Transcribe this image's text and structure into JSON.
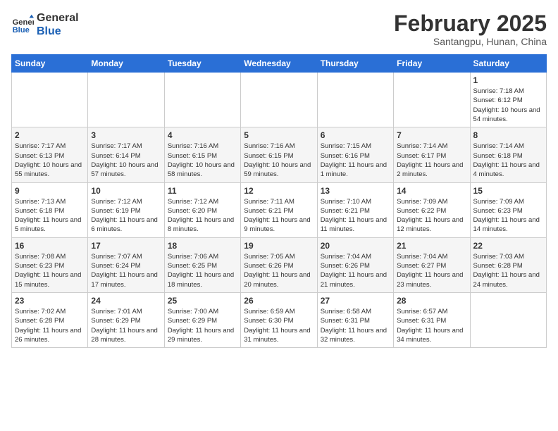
{
  "logo": {
    "line1": "General",
    "line2": "Blue"
  },
  "title": "February 2025",
  "location": "Santangpu, Hunan, China",
  "weekdays": [
    "Sunday",
    "Monday",
    "Tuesday",
    "Wednesday",
    "Thursday",
    "Friday",
    "Saturday"
  ],
  "weeks": [
    [
      {
        "day": "",
        "info": ""
      },
      {
        "day": "",
        "info": ""
      },
      {
        "day": "",
        "info": ""
      },
      {
        "day": "",
        "info": ""
      },
      {
        "day": "",
        "info": ""
      },
      {
        "day": "",
        "info": ""
      },
      {
        "day": "1",
        "info": "Sunrise: 7:18 AM\nSunset: 6:12 PM\nDaylight: 10 hours and 54 minutes."
      }
    ],
    [
      {
        "day": "2",
        "info": "Sunrise: 7:17 AM\nSunset: 6:13 PM\nDaylight: 10 hours and 55 minutes."
      },
      {
        "day": "3",
        "info": "Sunrise: 7:17 AM\nSunset: 6:14 PM\nDaylight: 10 hours and 57 minutes."
      },
      {
        "day": "4",
        "info": "Sunrise: 7:16 AM\nSunset: 6:15 PM\nDaylight: 10 hours and 58 minutes."
      },
      {
        "day": "5",
        "info": "Sunrise: 7:16 AM\nSunset: 6:15 PM\nDaylight: 10 hours and 59 minutes."
      },
      {
        "day": "6",
        "info": "Sunrise: 7:15 AM\nSunset: 6:16 PM\nDaylight: 11 hours and 1 minute."
      },
      {
        "day": "7",
        "info": "Sunrise: 7:14 AM\nSunset: 6:17 PM\nDaylight: 11 hours and 2 minutes."
      },
      {
        "day": "8",
        "info": "Sunrise: 7:14 AM\nSunset: 6:18 PM\nDaylight: 11 hours and 4 minutes."
      }
    ],
    [
      {
        "day": "9",
        "info": "Sunrise: 7:13 AM\nSunset: 6:18 PM\nDaylight: 11 hours and 5 minutes."
      },
      {
        "day": "10",
        "info": "Sunrise: 7:12 AM\nSunset: 6:19 PM\nDaylight: 11 hours and 6 minutes."
      },
      {
        "day": "11",
        "info": "Sunrise: 7:12 AM\nSunset: 6:20 PM\nDaylight: 11 hours and 8 minutes."
      },
      {
        "day": "12",
        "info": "Sunrise: 7:11 AM\nSunset: 6:21 PM\nDaylight: 11 hours and 9 minutes."
      },
      {
        "day": "13",
        "info": "Sunrise: 7:10 AM\nSunset: 6:21 PM\nDaylight: 11 hours and 11 minutes."
      },
      {
        "day": "14",
        "info": "Sunrise: 7:09 AM\nSunset: 6:22 PM\nDaylight: 11 hours and 12 minutes."
      },
      {
        "day": "15",
        "info": "Sunrise: 7:09 AM\nSunset: 6:23 PM\nDaylight: 11 hours and 14 minutes."
      }
    ],
    [
      {
        "day": "16",
        "info": "Sunrise: 7:08 AM\nSunset: 6:23 PM\nDaylight: 11 hours and 15 minutes."
      },
      {
        "day": "17",
        "info": "Sunrise: 7:07 AM\nSunset: 6:24 PM\nDaylight: 11 hours and 17 minutes."
      },
      {
        "day": "18",
        "info": "Sunrise: 7:06 AM\nSunset: 6:25 PM\nDaylight: 11 hours and 18 minutes."
      },
      {
        "day": "19",
        "info": "Sunrise: 7:05 AM\nSunset: 6:26 PM\nDaylight: 11 hours and 20 minutes."
      },
      {
        "day": "20",
        "info": "Sunrise: 7:04 AM\nSunset: 6:26 PM\nDaylight: 11 hours and 21 minutes."
      },
      {
        "day": "21",
        "info": "Sunrise: 7:04 AM\nSunset: 6:27 PM\nDaylight: 11 hours and 23 minutes."
      },
      {
        "day": "22",
        "info": "Sunrise: 7:03 AM\nSunset: 6:28 PM\nDaylight: 11 hours and 24 minutes."
      }
    ],
    [
      {
        "day": "23",
        "info": "Sunrise: 7:02 AM\nSunset: 6:28 PM\nDaylight: 11 hours and 26 minutes."
      },
      {
        "day": "24",
        "info": "Sunrise: 7:01 AM\nSunset: 6:29 PM\nDaylight: 11 hours and 28 minutes."
      },
      {
        "day": "25",
        "info": "Sunrise: 7:00 AM\nSunset: 6:29 PM\nDaylight: 11 hours and 29 minutes."
      },
      {
        "day": "26",
        "info": "Sunrise: 6:59 AM\nSunset: 6:30 PM\nDaylight: 11 hours and 31 minutes."
      },
      {
        "day": "27",
        "info": "Sunrise: 6:58 AM\nSunset: 6:31 PM\nDaylight: 11 hours and 32 minutes."
      },
      {
        "day": "28",
        "info": "Sunrise: 6:57 AM\nSunset: 6:31 PM\nDaylight: 11 hours and 34 minutes."
      },
      {
        "day": "",
        "info": ""
      }
    ]
  ]
}
